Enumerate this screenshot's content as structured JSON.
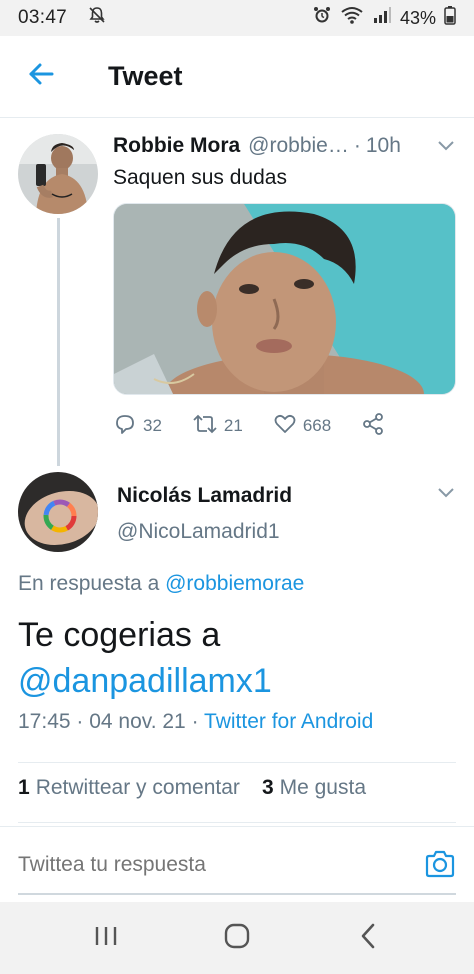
{
  "status_bar": {
    "time": "03:47",
    "battery": "43%",
    "icons": [
      "mute-icon",
      "alarm-icon",
      "wifi-icon",
      "signal-icon",
      "battery-icon"
    ]
  },
  "header": {
    "title": "Tweet"
  },
  "parent_tweet": {
    "name": "Robbie Mora",
    "handle": "@robbie…",
    "separator": "·",
    "time": "10h",
    "text": "Saquen sus dudas",
    "replies": "32",
    "retweets": "21",
    "likes": "668"
  },
  "tweet": {
    "name": "Nicolás Lamadrid",
    "handle": "@NicoLamadrid1",
    "reply_prefix": "En respuesta a ",
    "reply_mention": "@robbiemorae",
    "text": "Te cogerias a",
    "text_mention": "@danpadillamx1",
    "time_date": "17:45 · 04 nov. 21 · ",
    "source": "Twitter for Android",
    "retweets_count": "1",
    "retweets_label": "Retwittear y comentar",
    "likes_count": "3",
    "likes_label": "Me gusta"
  },
  "reply_bar": {
    "placeholder": "Twittea tu respuesta"
  },
  "colors": {
    "accent": "#1b95e0",
    "text": "#14171a",
    "secondary": "#657786"
  }
}
